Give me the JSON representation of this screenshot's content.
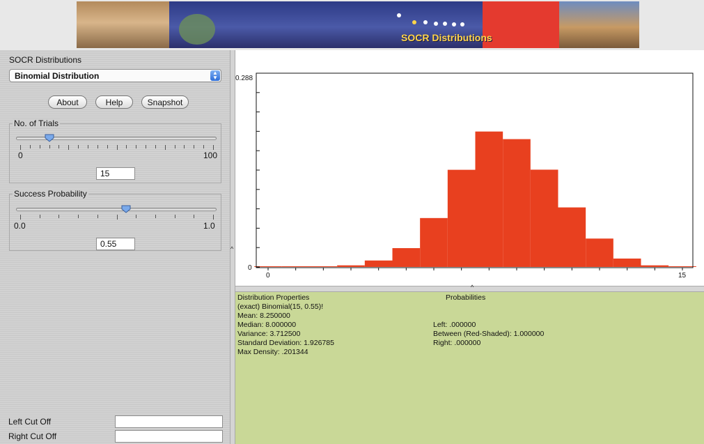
{
  "banner": {
    "title": "SOCR Distributions"
  },
  "panel": {
    "title": "SOCR Distributions",
    "distribution_selected": "Binomial Distribution",
    "buttons": {
      "about": "About",
      "help": "Help",
      "snapshot": "Snapshot"
    }
  },
  "trials": {
    "label": "No. of Trials",
    "min_label": "0",
    "max_label": "100",
    "value": "15",
    "fraction": 0.15
  },
  "probability": {
    "label": "Success Probability",
    "min_label": "0.0",
    "max_label": "1.0",
    "value": "0.55",
    "fraction": 0.55
  },
  "cutoffs": {
    "left_label": "Left Cut Off",
    "right_label": "Right Cut Off",
    "left_value": "",
    "right_value": ""
  },
  "chart_data": {
    "type": "bar",
    "title": "",
    "xlabel": "",
    "ylabel": "",
    "y_top_label": "0.288",
    "y_bottom_label": "0",
    "x_tick_labels": [
      "0",
      "15"
    ],
    "xlim": [
      0,
      15
    ],
    "ylim": [
      0,
      0.288
    ],
    "categories": [
      "0",
      "1",
      "2",
      "3",
      "4",
      "5",
      "6",
      "7",
      "8",
      "9",
      "10",
      "11",
      "12",
      "13",
      "14",
      "15"
    ],
    "values": [
      0.0,
      0.0,
      0.0004,
      0.0024,
      0.0096,
      0.028,
      0.0727,
      0.1444,
      0.2013,
      0.19,
      0.1446,
      0.0885,
      0.0422,
      0.0125,
      0.0024,
      0.0002
    ],
    "bar_color": "#e8401f"
  },
  "properties": {
    "heading": "Distribution Properties",
    "subtitle": "(exact) Binomial(15, 0.55)!",
    "mean": "Mean: 8.250000",
    "median": "Median: 8.000000",
    "variance": "Variance: 3.712500",
    "std": "Standard Deviation: 1.926785",
    "max_density": "Max Density: .201344"
  },
  "probabilities": {
    "heading": "Probabilities",
    "left": "Left: .000000",
    "between": "Between (Red-Shaded): 1.000000",
    "right": "Right: .000000"
  }
}
